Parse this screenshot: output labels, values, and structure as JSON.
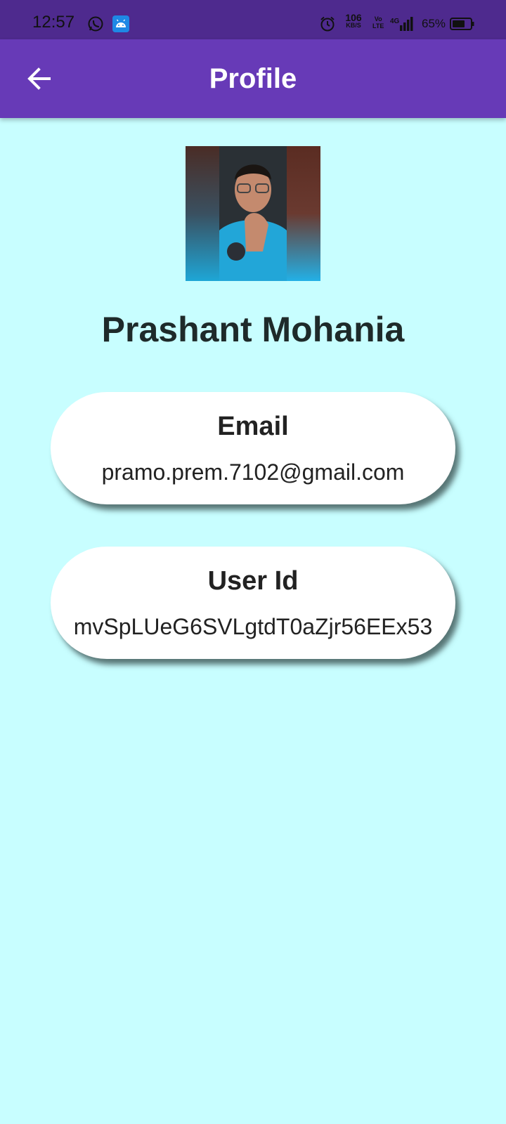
{
  "status_bar": {
    "time": "12:57",
    "net_speed_value": "106",
    "net_speed_unit": "KB/S",
    "volte_top": "Vo",
    "volte_bottom": "LTE",
    "network": "4G",
    "battery_percent": "65%",
    "icons": [
      "whatsapp-icon",
      "android-icon",
      "alarm-icon",
      "signal-icon",
      "battery-icon"
    ]
  },
  "app_bar": {
    "title": "Profile",
    "back_icon": "arrow-left-icon",
    "background": "#673ab7"
  },
  "profile": {
    "name": "Prashant Mohania",
    "cards": [
      {
        "title": "Email",
        "value": "pramo.prem.7102@gmail.com"
      },
      {
        "title": "User Id",
        "value": "mvSpLUeG6SVLgtdT0aZjr56EEx53"
      }
    ]
  },
  "colors": {
    "background": "#c8feff",
    "status_bar": "#4e2a8e",
    "card": "#ffffff"
  }
}
